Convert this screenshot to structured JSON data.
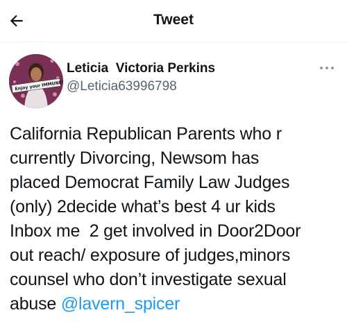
{
  "header": {
    "title": "Tweet",
    "back_icon": "arrow-left-icon"
  },
  "author": {
    "display_name": "Leticia  Victoria Perkins",
    "handle": "@Leticia63996798",
    "avatar_badge": "Enjoy your IMMUNET"
  },
  "more_icon": "more-horizontal-icon",
  "tweet": {
    "lines": [
      "California Republican Parents who r",
      "currently Divorcing, Newsom has",
      "placed Democrat Family Law Judges",
      "(only) 2decide what’s best 4 ur kids",
      "Inbox me  2 get involved in Door2Door",
      "out reach/ exposure of judges,minors",
      "counsel who don’t investigate sexual",
      "abuse "
    ],
    "mention": "@lavern_spicer"
  },
  "colors": {
    "text": "#0f1419",
    "secondary": "#536471",
    "link": "#1d9bf0"
  }
}
